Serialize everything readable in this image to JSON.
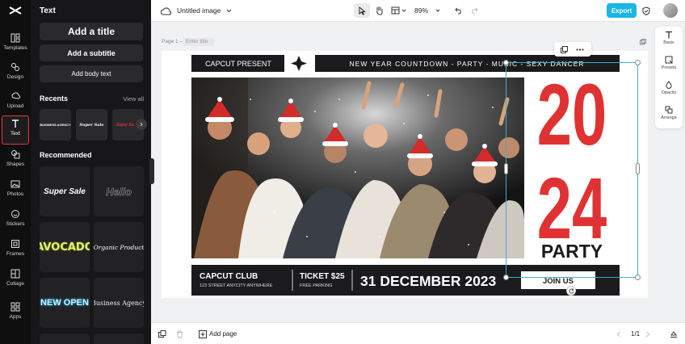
{
  "app": {
    "doc_title": "Untitled image",
    "zoom": "89%",
    "export_label": "Export"
  },
  "rail": [
    {
      "label": "Templates",
      "icon": "templates-icon"
    },
    {
      "label": "Design",
      "icon": "design-icon"
    },
    {
      "label": "Upload",
      "icon": "upload-icon"
    },
    {
      "label": "Text",
      "icon": "text-icon",
      "active": true
    },
    {
      "label": "Shapes",
      "icon": "shapes-icon"
    },
    {
      "label": "Photos",
      "icon": "photos-icon"
    },
    {
      "label": "Stickers",
      "icon": "stickers-icon"
    },
    {
      "label": "Frames",
      "icon": "frames-icon"
    },
    {
      "label": "Collage",
      "icon": "collage-icon"
    },
    {
      "label": "Apps",
      "icon": "apps-icon"
    }
  ],
  "panel": {
    "title": "Text",
    "add_title": "Add a title",
    "add_subtitle": "Add a subtitle",
    "add_body": "Add body text",
    "recents_label": "Recents",
    "view_all": "View all",
    "recents": [
      "BUSINESS AGENCY",
      "Super Sale",
      "Super Sa"
    ],
    "recommended_label": "Recommended",
    "recommended": [
      "Super Sale",
      "Hello",
      "AVOCADO",
      "Organic Product",
      "NEW OPEN",
      "Business Agency"
    ]
  },
  "canvas": {
    "page_label": "Page 1 –",
    "title_placeholder": "Enter title"
  },
  "right_tools": [
    "Basic",
    "Presets",
    "Opacity",
    "Arrange"
  ],
  "bottom": {
    "add_page": "Add page",
    "page_count": "1/1"
  },
  "poster": {
    "left_head": "CAPCUT PRESENT",
    "right_head": "NEW YEAR COUNTDOWN - PARTY - MUSIC - SEXY DANCER",
    "year_top": "20",
    "year_bottom": "24",
    "party": "PARTY",
    "club": "CAPCUT CLUB",
    "address": "123 STREET ANYCITY ANYWHERE",
    "ticket": "TICKET $25",
    "parking": "FREE PARKING",
    "date": "31 DECEMBER 2023",
    "cta": "JOIN US"
  },
  "colors": {
    "accent": "#e03232",
    "export": "#19b6e6",
    "selection": "#3ab0c8",
    "dark": "#1b1b1e"
  }
}
